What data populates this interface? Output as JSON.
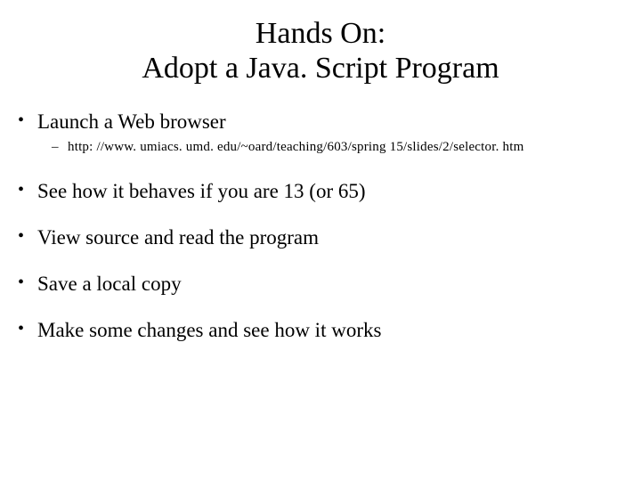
{
  "title": {
    "line1": "Hands On:",
    "line2": "Adopt a Java. Script Program"
  },
  "bullets": [
    {
      "text": "Launch a Web browser",
      "sub": [
        "http: //www. umiacs. umd. edu/~oard/teaching/603/spring 15/slides/2/selector. htm"
      ]
    },
    {
      "text": "See how it behaves if you are 13 (or 65)"
    },
    {
      "text": "View source and read the program"
    },
    {
      "text": "Save a local copy"
    },
    {
      "text": "Make some changes and see how it works"
    }
  ]
}
